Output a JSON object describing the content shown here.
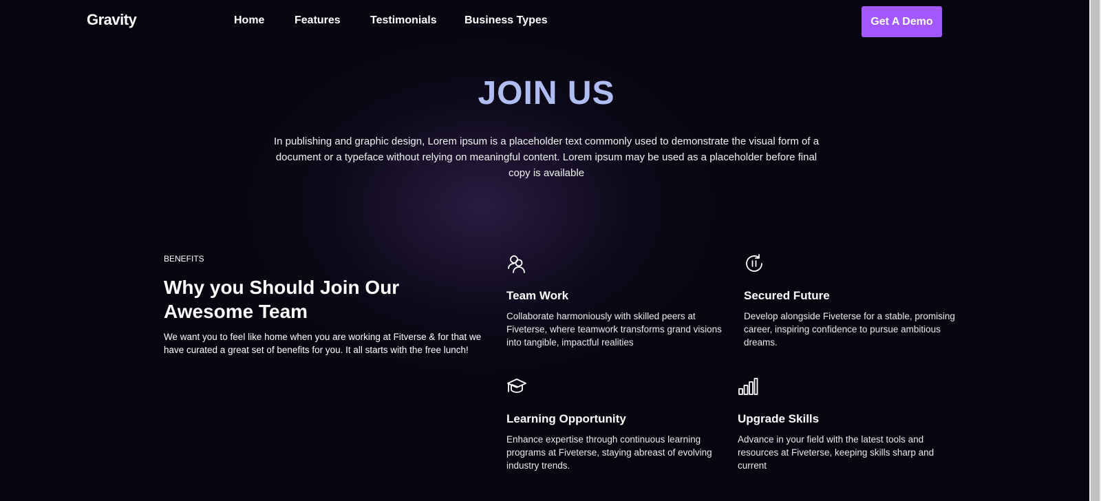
{
  "nav": {
    "logo": "Gravity",
    "links": [
      "Home",
      "Features",
      "Testimonials",
      "Business Types"
    ],
    "cta": "Get A Demo"
  },
  "hero": {
    "title": "JOIN US",
    "text": "In publishing and graphic design, Lorem ipsum is a placeholder text commonly used to demonstrate the visual form of a document or a typeface without relying on meaningful content. Lorem ipsum may be used as a placeholder before final copy is available"
  },
  "benefits": {
    "eyebrow": "BENEFITS",
    "title": "Why you Should Join Our Awesome Team",
    "description": "We want you to feel like home when you are working at Fitverse & for that we have curated a great set of benefits for you. It all starts with the free lunch!",
    "cards": [
      {
        "icon": "team-icon",
        "title": "Team Work",
        "text": "Collaborate harmoniously with skilled peers at Fiveterse, where teamwork transforms grand visions into tangible, impactful realities"
      },
      {
        "icon": "secured-future-icon",
        "title": "Secured Future",
        "text": "Develop alongside Fiveterse for a stable, promising career, inspiring confidence to pursue ambitious dreams."
      },
      {
        "icon": "graduation-cap-icon",
        "title": "Learning Opportunity",
        "text": "Enhance expertise through continuous learning programs at Fiveterse, staying abreast of evolving industry trends."
      },
      {
        "icon": "bar-chart-icon",
        "title": "Upgrade Skills",
        "text": "Advance in your field with the latest tools and resources at Fiveterse, keeping skills sharp and current"
      }
    ]
  },
  "colors": {
    "background": "#07050f",
    "accent": "#a259ff",
    "hero_title": "#b0bdf2"
  }
}
